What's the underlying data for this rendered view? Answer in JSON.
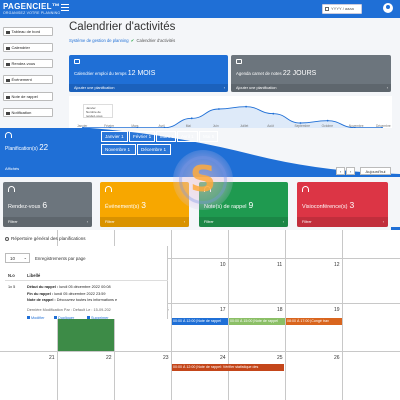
{
  "brand": {
    "name": "PAGENCIEL™",
    "subtitle": "ORGANISEZ VOTRE PLANNING"
  },
  "header": {
    "date_value": "YYYY / aaaa"
  },
  "sidebar": {
    "items": [
      {
        "label": "Tableau de bord"
      },
      {
        "label": "Calendrier"
      },
      {
        "label": "Rendez-vous"
      },
      {
        "label": "Événement"
      },
      {
        "label": "Note de rappel"
      },
      {
        "label": "Notification"
      }
    ]
  },
  "page": {
    "title": "Calendrier d'activités",
    "breadcrumb_root": "Système de gestion de planning",
    "breadcrumb_current": "Calendrier d'activités"
  },
  "info_cards": [
    {
      "label": "Calendrier emploi du temps",
      "value": "12 MOIS",
      "footer": "Ajouter une planification",
      "color": "#1f6fd6"
    },
    {
      "label": "Agenda carnet de notes",
      "value": "22 JOURS",
      "footer": "Ajouter une planification",
      "color": "#6c757d"
    }
  ],
  "chart_data": {
    "type": "area",
    "x": [
      "Janvier",
      "Février",
      "Mars",
      "Avril",
      "Mai",
      "Juin",
      "Juillet",
      "Août",
      "Septembre",
      "Octobre",
      "Novembre",
      "Décembre"
    ],
    "series": [
      {
        "name": "Nombre de rendez-vous",
        "values": [
          1,
          1,
          1,
          1,
          5,
          9,
          10,
          7,
          3,
          4,
          1,
          1
        ]
      }
    ],
    "legend_title": "Janvier",
    "ylim": [
      0,
      12
    ],
    "grid": false,
    "legend": "top-left"
  },
  "planification": {
    "label": "Planification(s)",
    "count": "22",
    "footer": "Affichés",
    "months": [
      {
        "label": "Janvier",
        "count": "1"
      },
      {
        "label": "Février",
        "count": "1"
      },
      {
        "label": "Mars",
        "count": "1"
      },
      {
        "label": "Avril",
        "count": "1"
      },
      {
        "label": "Mai",
        "count": "5"
      },
      {
        "label": "Novembre",
        "count": "1"
      },
      {
        "label": "Décembre",
        "count": "1"
      }
    ]
  },
  "pager": {
    "prev": "‹",
    "next": "›",
    "today": "Aujourd'hui"
  },
  "categories": [
    {
      "label": "Rendez-vous",
      "count": "6",
      "footer": "Filtrer",
      "color": "#6c757d"
    },
    {
      "label": "Événement(s)",
      "count": "3",
      "footer": "Filtrer",
      "color": "#f7a700"
    },
    {
      "label": "Note(s) de rappel",
      "count": "9",
      "footer": "Filtrer",
      "color": "#1f9a50"
    },
    {
      "label": "Visioconférence(s)",
      "count": "3",
      "footer": "Filtrer",
      "color": "#dc3545"
    }
  ],
  "repertoire": {
    "title": "Répertoire général des planifications"
  },
  "table": {
    "per_page_value": "10",
    "per_page_label": "Enregistrements par page",
    "columns": [
      "N.o",
      "Libellé"
    ],
    "row": {
      "number": "1",
      "suffix": "1x 5",
      "debut_label": "Début du rappel :",
      "debut_value": "lundi 05 décembre 2022 00:08",
      "fin_label": "Fin du rappel :",
      "fin_value": "lundi 05 décembre 2022 23:59",
      "note_label": "Note de rappel :",
      "note_value": "Découvrez toutes les informations e",
      "modified": "Dernière Modification Par : Default Le : 15-09-202",
      "actions": [
        "Modifier",
        "Dupliquer",
        "Supprimer"
      ]
    }
  },
  "calendar": {
    "days": [
      "9",
      "10",
      "11",
      "12",
      "16",
      "17",
      "18",
      "19",
      "21",
      "22",
      "23",
      "24",
      "25",
      "26"
    ],
    "events": [
      {
        "text": "00:00 À 12:00 |Note de rappel",
        "color": "#1f6fd6"
      },
      {
        "text": "00:00 À 15:00 |Note de rappel",
        "color": "#8bbf66"
      },
      {
        "text": "08:00 À 17:00 |Congé trav",
        "color": "#d9651e"
      },
      {
        "text": "00:00 À 12:00 |Note de rappel: Vérifier statistique des",
        "color": "#c4461a"
      }
    ]
  }
}
